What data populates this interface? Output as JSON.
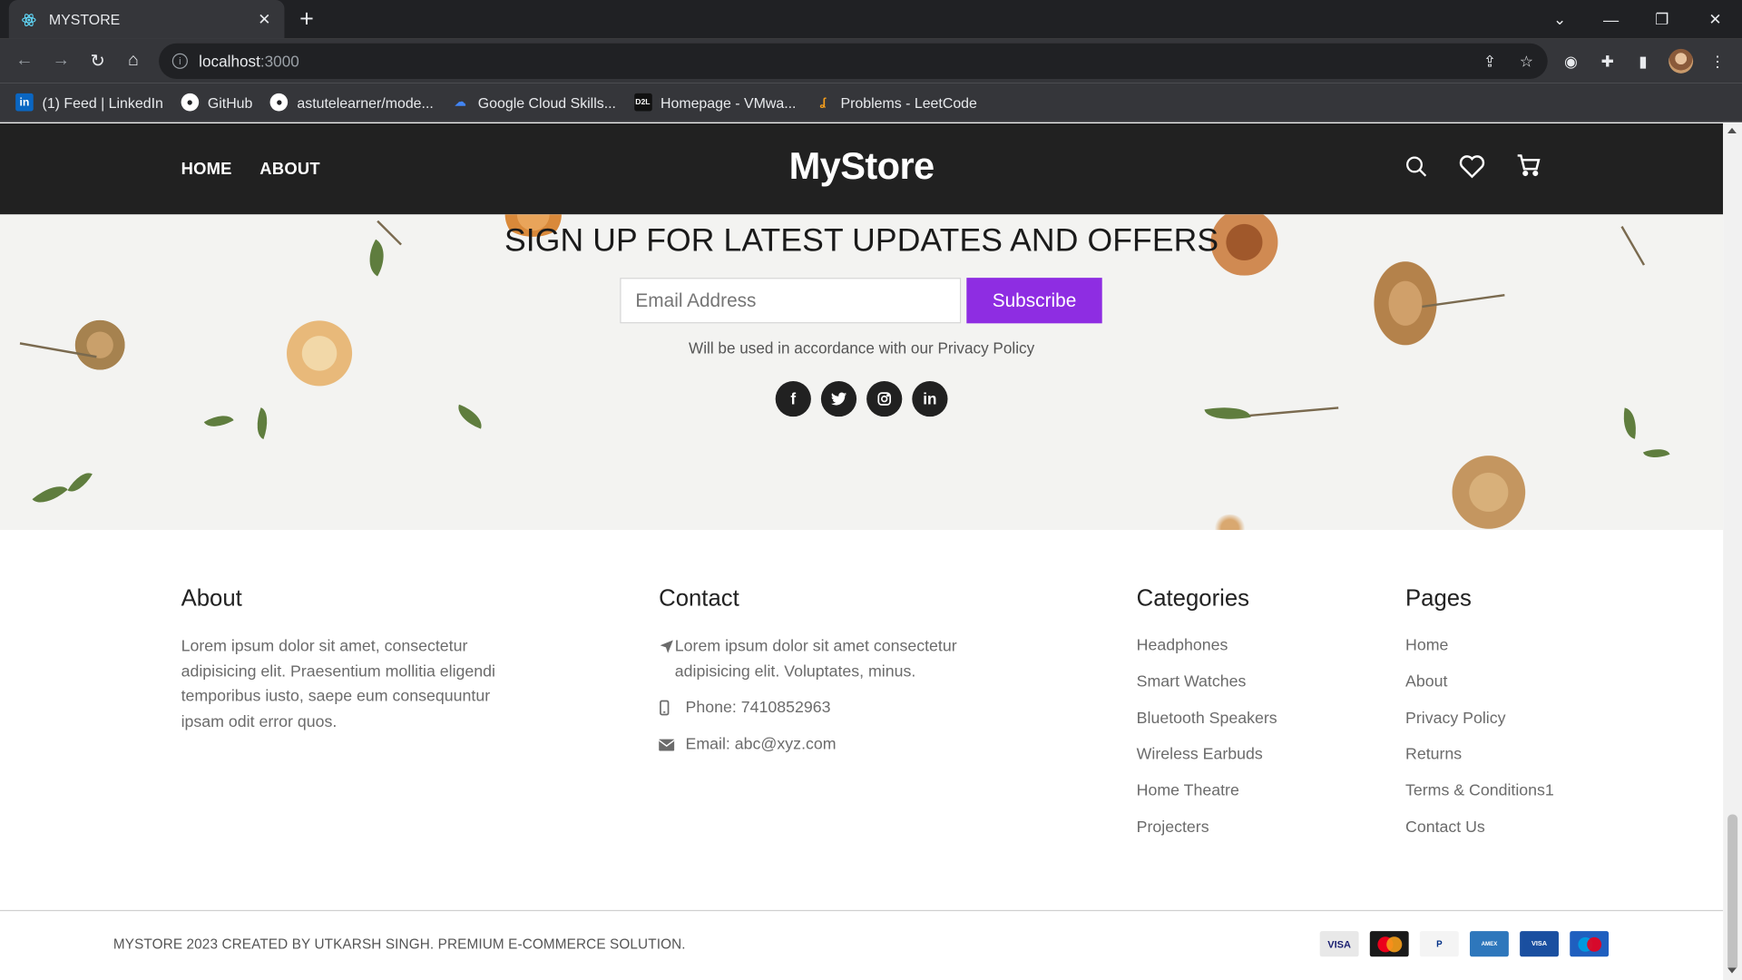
{
  "browser": {
    "tab_title": "MYSTORE",
    "url_host": "localhost",
    "url_port": ":3000",
    "bookmarks": [
      {
        "label": "(1) Feed | LinkedIn",
        "icon": "linkedin-icon"
      },
      {
        "label": "GitHub",
        "icon": "github-icon"
      },
      {
        "label": "astutelearner/mode...",
        "icon": "github-icon"
      },
      {
        "label": "Google Cloud Skills...",
        "icon": "google-cloud-icon"
      },
      {
        "label": "Homepage - VMwa...",
        "icon": "d2l-icon"
      },
      {
        "label": "Problems - LeetCode",
        "icon": "leetcode-icon"
      }
    ]
  },
  "header": {
    "nav": [
      "HOME",
      "ABOUT"
    ],
    "logo": "MyStore"
  },
  "newsletter": {
    "title": "SIGN UP FOR LATEST UPDATES AND OFFERS",
    "email_placeholder": "Email Address",
    "subscribe_label": "Subscribe",
    "note": "Will be used in accordance with our Privacy Policy",
    "accent": "#8e2de2"
  },
  "footer": {
    "about": {
      "title": "About",
      "text": "Lorem ipsum dolor sit amet, consectetur adipisicing elit. Praesentium mollitia eligendi temporibus iusto, saepe eum consequuntur ipsam odit error quos."
    },
    "contact": {
      "title": "Contact",
      "address": "Lorem ipsum dolor sit amet consectetur adipisicing elit. Voluptates, minus.",
      "phone": "Phone: 7410852963",
      "email": "Email: abc@xyz.com"
    },
    "categories": {
      "title": "Categories",
      "items": [
        "Headphones",
        "Smart Watches",
        "Bluetooth Speakers",
        "Wireless Earbuds",
        "Home Theatre",
        "Projecters"
      ]
    },
    "pages": {
      "title": "Pages",
      "items": [
        "Home",
        "About",
        "Privacy Policy",
        "Returns",
        "Terms & Conditions1",
        "Contact Us"
      ]
    },
    "copyright": "MYSTORE 2023 CREATED BY UTKARSH SINGH. PREMIUM E-COMMERCE SOLUTION.",
    "payment_cards": [
      {
        "label": "VISA",
        "color": "#e8e8e8"
      },
      {
        "label": "MasterCard",
        "color": "#e84c22"
      },
      {
        "label": "PayPal",
        "color": "#f4f4f4"
      },
      {
        "label": "AMERICAN EXPRESS",
        "color": "#2e77bc"
      },
      {
        "label": "VISA Electron",
        "color": "#1a4fa0"
      },
      {
        "label": "Maestro",
        "color": "#1f5fbf"
      }
    ]
  }
}
